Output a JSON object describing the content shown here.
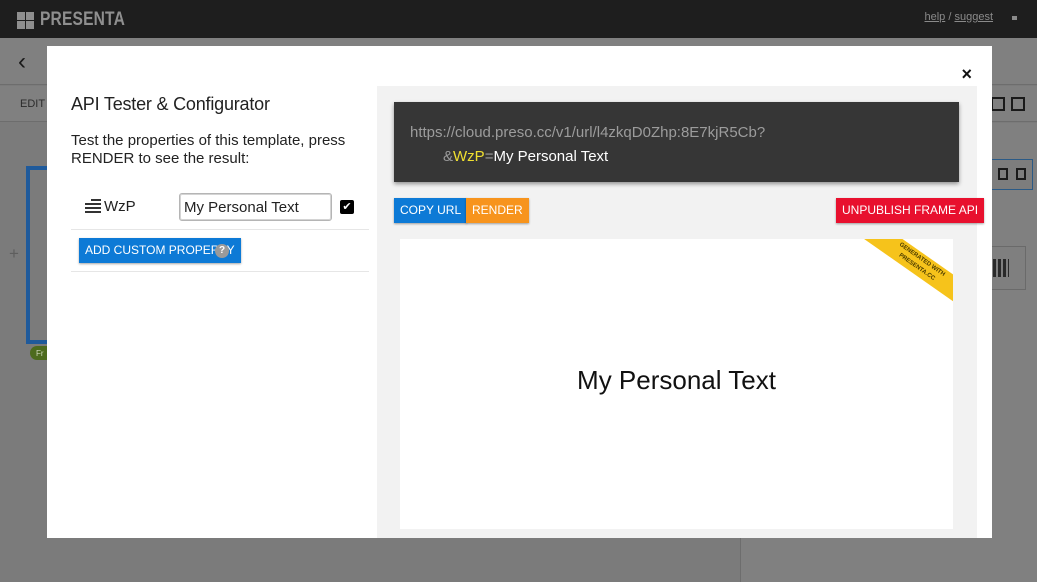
{
  "app": {
    "logo_text": "PRESENTA",
    "help_link": "help",
    "separator": "/",
    "suggest_link": "suggest"
  },
  "background": {
    "edit_label": "EDIT F",
    "frame_label": "Fr"
  },
  "modal": {
    "title": "API Tester & Configurator",
    "description": "Test the properties of this template, press RENDER to see the result:",
    "close_label": "×",
    "property": {
      "name": "WzP",
      "value": "My Personal Text",
      "enabled": true
    },
    "add_custom_property_label": "ADD CUSTOM PROPERTY",
    "help_label": "?",
    "url": {
      "base": "https://cloud.preso.cc/v1/url/l4zkqD0Zhp:8E7kjR5Cb?",
      "amp": "&",
      "key": "WzP",
      "eq": "=",
      "value": "My Personal Text"
    },
    "buttons": {
      "copy_url": "COPY URL",
      "render": "RENDER",
      "unpublish": "UNPUBLISH FRAME API"
    },
    "preview": {
      "text": "My Personal Text",
      "ribbon_line1": "GENERATED WITH",
      "ribbon_line2": "PRESENTA.CC"
    }
  },
  "colors": {
    "accent_blue": "#0d7ad6",
    "render_orange": "#f7941d",
    "unpublish_red": "#e8102e",
    "ribbon_yellow": "#f6c31b",
    "url_key_yellow": "#f0e030"
  }
}
